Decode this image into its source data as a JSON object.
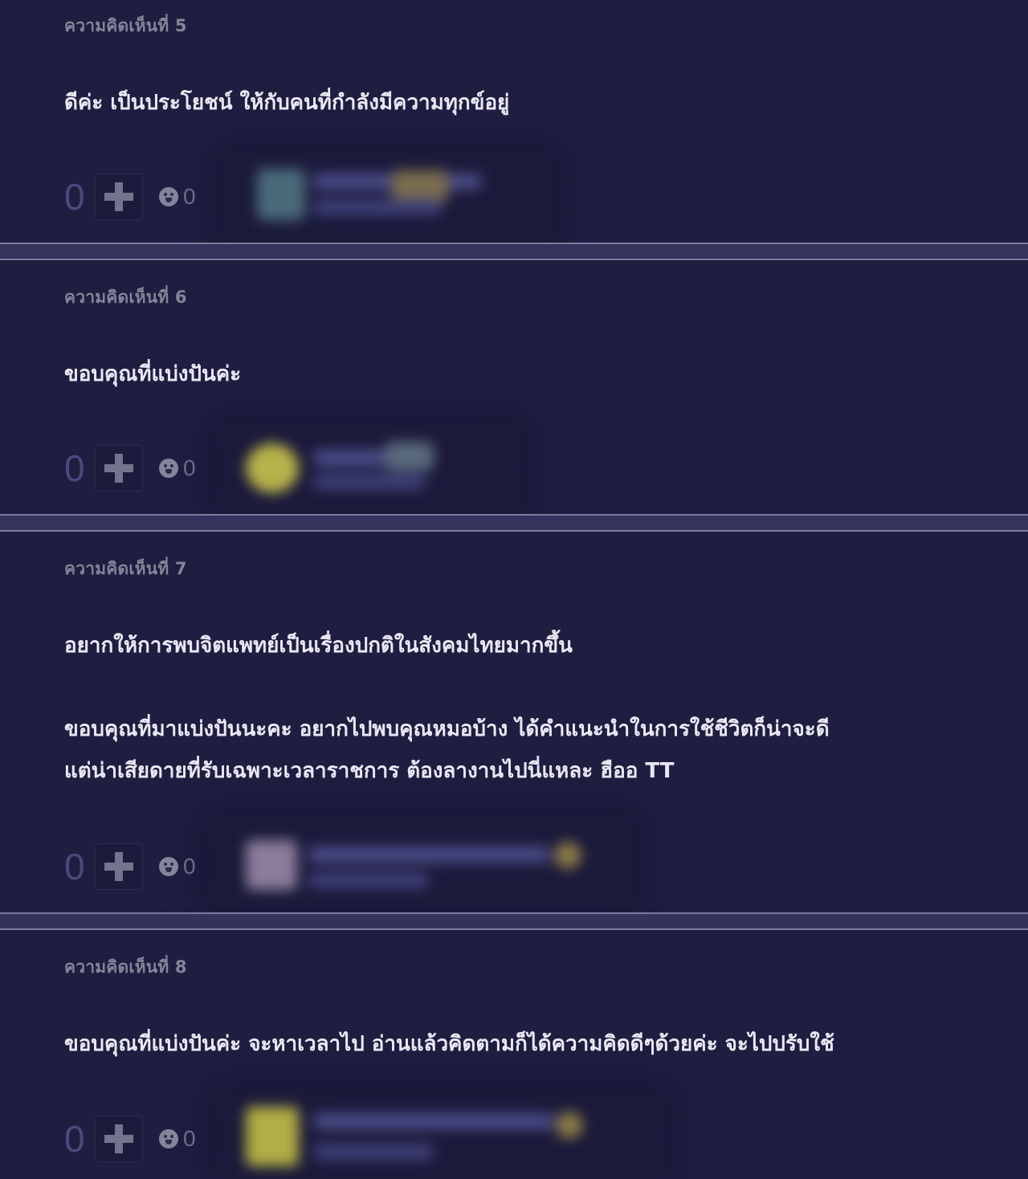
{
  "comments": [
    {
      "number_label": "ความคิดเห็นที่ 5",
      "body": "ดีค่ะ เป็นประโยชน์ ให้กับคนที่กำลังมีความทุกข์อยู่",
      "vote_count": "0",
      "emotion_count": "0"
    },
    {
      "number_label": "ความคิดเห็นที่ 6",
      "body": "ขอบคุณที่แบ่งปันค่ะ",
      "vote_count": "0",
      "emotion_count": "0"
    },
    {
      "number_label": "ความคิดเห็นที่ 7",
      "body": "อยากให้การพบจิตแพทย์เป็นเรื่องปกติในสังคมไทยมากขึ้น\n\nขอบคุณที่มาแบ่งปันนะคะ อยากไปพบคุณหมอบ้าง ได้คำแนะนำในการใช้ชีวิตก็น่าจะดี\nแต่น่าเสียดายที่รับเฉพาะเวลาราชการ ต้องลางานไปนี่แหละ ฮืออ TT",
      "vote_count": "0",
      "emotion_count": "0"
    },
    {
      "number_label": "ความคิดเห็นที่ 8",
      "body": "ขอบคุณที่แบ่งปันค่ะ จะหาเวลาไป อ่านแล้วคิดตามก็ได้ความคิดดีๆด้วยค่ะ จะไปปรับใช้",
      "vote_count": "0",
      "emotion_count": "0"
    }
  ],
  "icons": {
    "vote": "plus-icon",
    "emotion": "emotion-icon"
  },
  "colors": {
    "background": "#1f1e40",
    "separator": "#34335b",
    "text": "#e9e8f2",
    "muted": "#85859a",
    "vote_count": "#4a4980"
  }
}
